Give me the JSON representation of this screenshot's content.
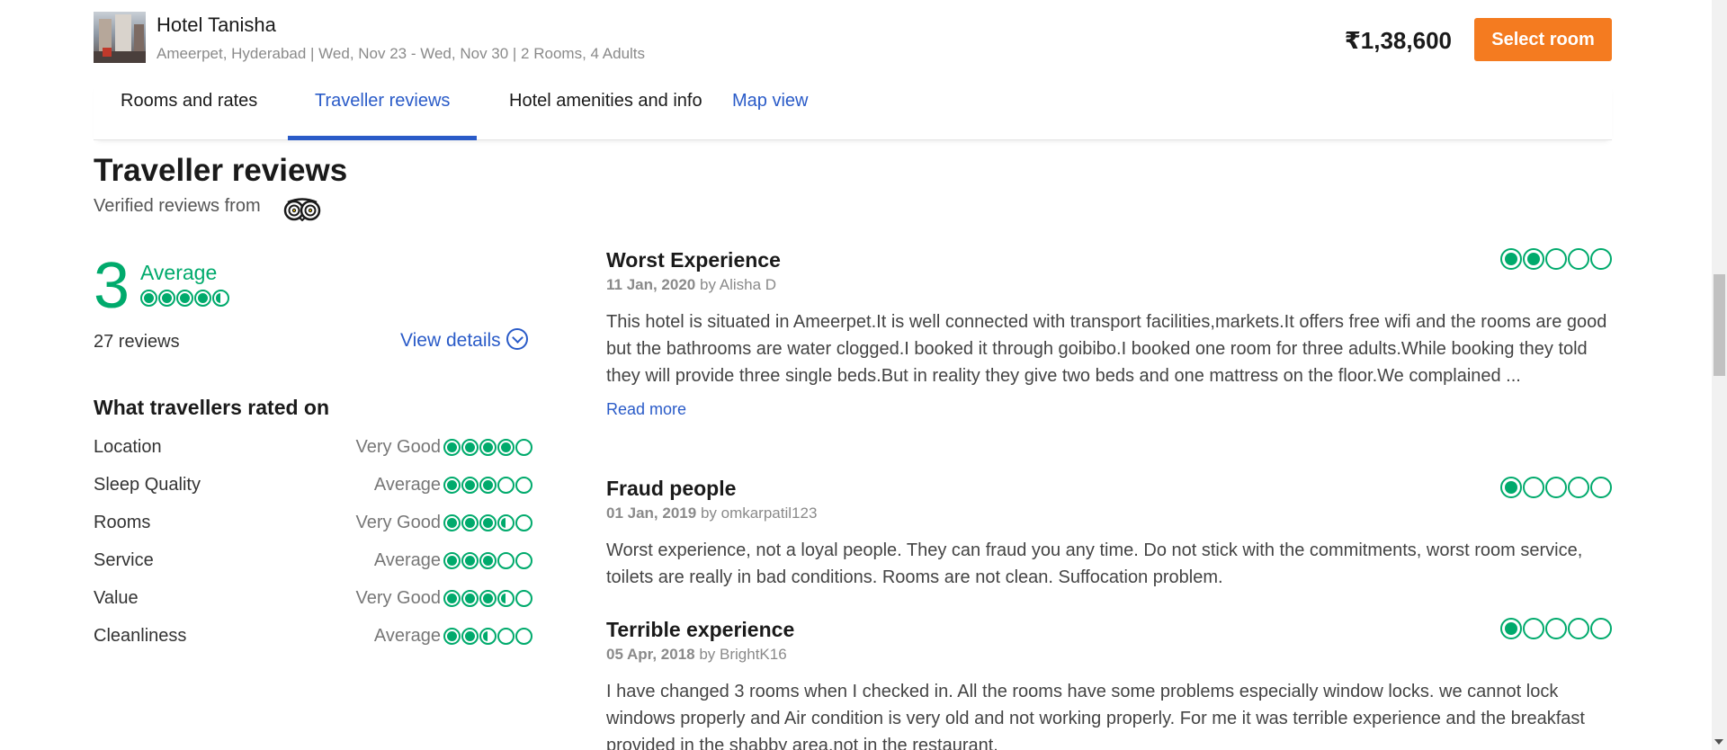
{
  "header": {
    "hotel_name": "Hotel Tanisha",
    "hotel_meta": "Ameerpet, Hyderabad | Wed, Nov 23 - Wed, Nov 30 | 2 Rooms, 4 Adults",
    "price": "₹1,38,600",
    "select_label": "Select room",
    "accent_color": "#f47b20"
  },
  "tabs": [
    {
      "label": "Rooms and rates",
      "active": false
    },
    {
      "label": "Traveller reviews",
      "active": true
    },
    {
      "label": "Hotel amenities and info",
      "active": false
    },
    {
      "label": "Map view",
      "active": false
    }
  ],
  "section": {
    "title": "Traveller reviews",
    "verified": "Verified reviews from",
    "source_icon": "tripadvisor-owl-icon"
  },
  "summary": {
    "score": "3",
    "label": "Average",
    "bubbles": 4.5,
    "review_count": "27 reviews",
    "view_details": "View details"
  },
  "rated_on": {
    "title": "What travellers rated on",
    "items": [
      {
        "category": "Location",
        "level": "Very Good",
        "bubbles": 4
      },
      {
        "category": "Sleep Quality",
        "level": "Average",
        "bubbles": 3
      },
      {
        "category": "Rooms",
        "level": "Very Good",
        "bubbles": 3.5
      },
      {
        "category": "Service",
        "level": "Average",
        "bubbles": 3
      },
      {
        "category": "Value",
        "level": "Very Good",
        "bubbles": 3.5
      },
      {
        "category": "Cleanliness",
        "level": "Average",
        "bubbles": 2.5
      }
    ]
  },
  "reviews": [
    {
      "title": "Worst Experience",
      "date": "11 Jan, 2020",
      "by": "by Alisha D",
      "bubbles": 2,
      "body": "This hotel is situated in Ameerpet.It is well connected with transport facilities,markets.It offers free wifi and the rooms are good but the bathrooms are water clogged.I booked it through goibibo.I booked one room for three adults.While booking they told they will provide three single beds.But in reality they give two beds and one mattress on the floor.We complained ...",
      "read_more": "Read more"
    },
    {
      "title": "Fraud people",
      "date": "01 Jan, 2019",
      "by": "by omkarpatil123",
      "bubbles": 1,
      "body": "Worst experience, not a loyal people. They can fraud you any time. Do not stick with the commitments, worst room service, toilets are really in bad conditions. Rooms are not clean. Suffocation problem.",
      "read_more": ""
    },
    {
      "title": "Terrible experience",
      "date": "05 Apr, 2018",
      "by": "by BrightK16",
      "bubbles": 1,
      "body": "I have changed 3 rooms when I checked in. All the rooms have some problems especially window locks. we cannot lock windows properly and Air condition is very old and not working properly. For me it was terrible experience and the breakfast provided in the shabby area,not in the restaurant.",
      "read_more": ""
    }
  ],
  "colors": {
    "rating_green": "#00aa6c",
    "link_blue": "#2a5bc8"
  }
}
